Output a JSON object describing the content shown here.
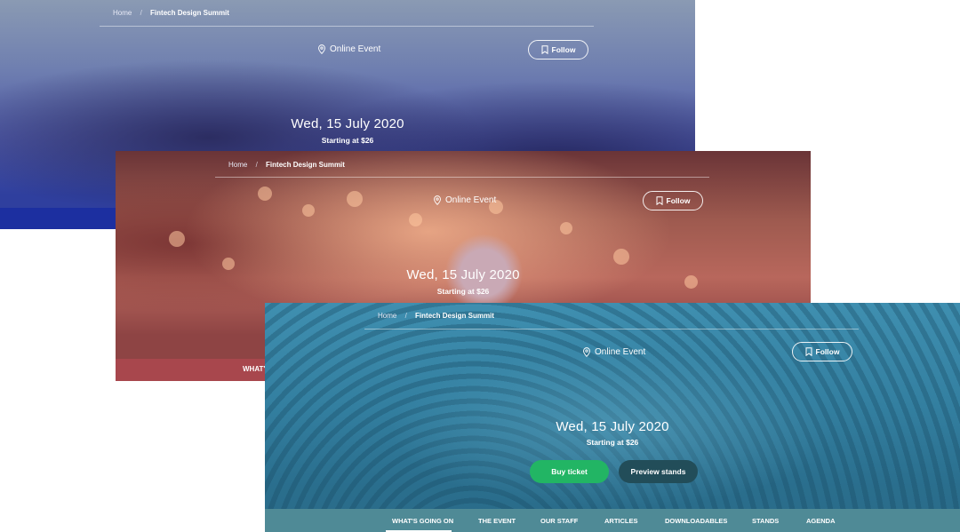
{
  "cards": [
    {
      "breadcrumb": {
        "home": "Home",
        "separator": "/",
        "current": "Fintech Design Summit"
      },
      "location": "Online Event",
      "follow_label": "Follow",
      "date": "Wed, 15 July 2020",
      "starting": "Starting at $26",
      "accent_color": "#1c2fa0"
    },
    {
      "breadcrumb": {
        "home": "Home",
        "separator": "/",
        "current": "Fintech Design Summit"
      },
      "location": "Online Event",
      "follow_label": "Follow",
      "date": "Wed, 15 July 2020",
      "starting": "Starting at $26",
      "tab_partial": "WHAT'S",
      "accent_color": "#a8474d"
    },
    {
      "breadcrumb": {
        "home": "Home",
        "separator": "/",
        "current": "Fintech Design Summit"
      },
      "location": "Online Event",
      "follow_label": "Follow",
      "date": "Wed, 15 July 2020",
      "starting": "Starting at $26",
      "buy_label": "Buy ticket",
      "preview_label": "Preview stands",
      "tabs": [
        "WHAT'S GOING ON",
        "THE EVENT",
        "OUR STAFF",
        "ARTICLES",
        "DOWNLOADABLES",
        "STANDS",
        "AGENDA"
      ],
      "active_tab": "WHAT'S GOING ON",
      "accent_color": "#4f8a96",
      "buy_color": "#22b564",
      "preview_color": "#224d59"
    }
  ],
  "icons": {
    "location": "map-pin-icon",
    "follow": "bookmark-icon"
  }
}
